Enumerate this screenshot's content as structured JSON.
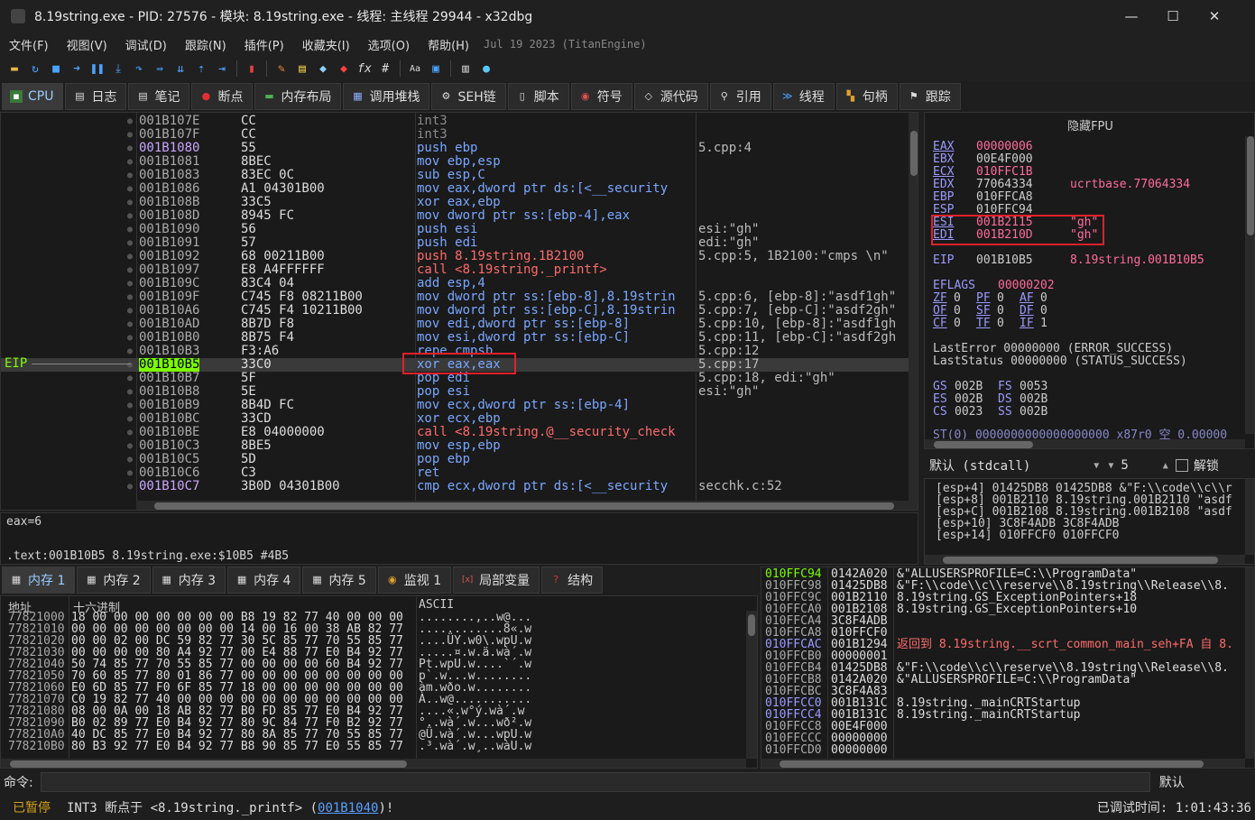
{
  "window": {
    "title": "8.19string.exe - PID: 27576 - 模块: 8.19string.exe - 线程: 主线程 29944 - x32dbg",
    "minimize": "—",
    "maximize": "☐",
    "close": "✕"
  },
  "menu": {
    "items": [
      "文件(F)",
      "视图(V)",
      "调试(D)",
      "跟踪(N)",
      "插件(P)",
      "收藏夹(I)",
      "选项(O)",
      "帮助(H)"
    ],
    "date": "Jul 19 2023 (TitanEngine)"
  },
  "tabs": [
    "CPU",
    "日志",
    "笔记",
    "断点",
    "内存布局",
    "调用堆栈",
    "SEH链",
    "脚本",
    "符号",
    "源代码",
    "引用",
    "线程",
    "句柄",
    "跟踪"
  ],
  "disasm": {
    "eip_label": "EIP",
    "rows": [
      {
        "addr": "001B107E",
        "bytes": "CC",
        "instr": "int3",
        "cmt": ""
      },
      {
        "addr": "001B107F",
        "bytes": "CC",
        "instr": "int3",
        "cmt": ""
      },
      {
        "addr": "001B1080",
        "bytes": "55",
        "instr": "push ebp",
        "cmt": "5.cpp:4"
      },
      {
        "addr": "001B1081",
        "bytes": "8BEC",
        "instr": "mov ebp,esp",
        "cmt": ""
      },
      {
        "addr": "001B1083",
        "bytes": "83EC 0C",
        "instr": "sub esp,C",
        "cmt": ""
      },
      {
        "addr": "001B1086",
        "bytes": "A1 04301B00",
        "instr": "mov eax,dword ptr ds:[<__security",
        "cmt": ""
      },
      {
        "addr": "001B108B",
        "bytes": "33C5",
        "instr": "xor eax,ebp",
        "cmt": ""
      },
      {
        "addr": "001B108D",
        "bytes": "8945 FC",
        "instr": "mov dword ptr ss:[ebp-4],eax",
        "cmt": ""
      },
      {
        "addr": "001B1090",
        "bytes": "56",
        "instr": "push esi",
        "cmt": "esi:\"gh\""
      },
      {
        "addr": "001B1091",
        "bytes": "57",
        "instr": "push edi",
        "cmt": "edi:\"gh\""
      },
      {
        "addr": "001B1092",
        "bytes": "68 00211B00",
        "instr": "push 8.19string.1B2100",
        "cmt": "5.cpp:5, 1B2100:\"cmps \\n\""
      },
      {
        "addr": "001B1097",
        "bytes": "E8 A4FFFFFF",
        "instr": "call <8.19string._printf>",
        "cmt": ""
      },
      {
        "addr": "001B109C",
        "bytes": "83C4 04",
        "instr": "add esp,4",
        "cmt": ""
      },
      {
        "addr": "001B109F",
        "bytes": "C745 F8 08211B00",
        "instr": "mov dword ptr ss:[ebp-8],8.19strin",
        "cmt": "5.cpp:6, [ebp-8]:\"asdf1gh\""
      },
      {
        "addr": "001B10A6",
        "bytes": "C745 F4 10211B00",
        "instr": "mov dword ptr ss:[ebp-C],8.19strin",
        "cmt": "5.cpp:7, [ebp-C]:\"asdf2gh\""
      },
      {
        "addr": "001B10AD",
        "bytes": "8B7D F8",
        "instr": "mov edi,dword ptr ss:[ebp-8]",
        "cmt": "5.cpp:10, [ebp-8]:\"asdf1gh"
      },
      {
        "addr": "001B10B0",
        "bytes": "8B75 F4",
        "instr": "mov esi,dword ptr ss:[ebp-C]",
        "cmt": "5.cpp:11, [ebp-C]:\"asdf2gh"
      },
      {
        "addr": "001B10B3",
        "bytes": "F3:A6",
        "instr": "repe cmpsb",
        "cmt": "5.cpp:12"
      },
      {
        "addr": "001B10B5",
        "bytes": "33C0",
        "instr": "xor eax,eax",
        "cmt": "5.cpp:17"
      },
      {
        "addr": "001B10B7",
        "bytes": "5F",
        "instr": "pop edi",
        "cmt": "5.cpp:18, edi:\"gh\""
      },
      {
        "addr": "001B10B8",
        "bytes": "5E",
        "instr": "pop esi",
        "cmt": "esi:\"gh\""
      },
      {
        "addr": "001B10B9",
        "bytes": "8B4D FC",
        "instr": "mov ecx,dword ptr ss:[ebp-4]",
        "cmt": ""
      },
      {
        "addr": "001B10BC",
        "bytes": "33CD",
        "instr": "xor ecx,ebp",
        "cmt": ""
      },
      {
        "addr": "001B10BE",
        "bytes": "E8 04000000",
        "instr": "call <8.19string.@__security_check",
        "cmt": ""
      },
      {
        "addr": "001B10C3",
        "bytes": "8BE5",
        "instr": "mov esp,ebp",
        "cmt": ""
      },
      {
        "addr": "001B10C5",
        "bytes": "5D",
        "instr": "pop ebp",
        "cmt": ""
      },
      {
        "addr": "001B10C6",
        "bytes": "C3",
        "instr": "ret",
        "cmt": ""
      },
      {
        "addr": "001B10C7",
        "bytes": "3B0D 04301B00",
        "instr": "cmp ecx,dword ptr ds:[<__security",
        "cmt": "secchk.c:52"
      }
    ]
  },
  "info": {
    "line1": "eax=6",
    "line2": ".text:001B10B5 8.19string.exe:$10B5 #4B5"
  },
  "registers": {
    "header": "隐藏FPU",
    "gp": [
      {
        "name": "EAX",
        "value": "00000006",
        "extra": ""
      },
      {
        "name": "EBX",
        "value": "00E4F000",
        "extra": ""
      },
      {
        "name": "ECX",
        "value": "010FFC1B",
        "extra": ""
      },
      {
        "name": "EDX",
        "value": "77064334",
        "extra": "ucrtbase.77064334"
      },
      {
        "name": "EBP",
        "value": "010FFCA8",
        "extra": ""
      },
      {
        "name": "ESP",
        "value": "010FFC94",
        "extra": ""
      },
      {
        "name": "ESI",
        "value": "001B2115",
        "extra": "\"gh\""
      },
      {
        "name": "EDI",
        "value": "001B210D",
        "extra": "\"gh\""
      }
    ],
    "eip": {
      "name": "EIP",
      "value": "001B10B5",
      "extra": "8.19string.001B10B5"
    },
    "eflags": {
      "name": "EFLAGS",
      "value": "00000202"
    },
    "flags": [
      [
        "ZF",
        "0",
        "PF",
        "0",
        "AF",
        "0"
      ],
      [
        "OF",
        "0",
        "SF",
        "0",
        "DF",
        "0"
      ],
      [
        "CF",
        "0",
        "TF",
        "0",
        "IF",
        "1"
      ]
    ],
    "lasterror": "LastError  00000000 (ERROR_SUCCESS)",
    "laststatus": "LastStatus 00000000 (STATUS_SUCCESS)",
    "segs": [
      [
        "GS",
        "002B",
        "FS",
        "0053"
      ],
      [
        "ES",
        "002B",
        "DS",
        "002B"
      ],
      [
        "CS",
        "0023",
        "SS",
        "002B"
      ]
    ],
    "st0": "ST(0) 0000000000000000000 x87r0 空 0.00000"
  },
  "callconv": {
    "value": "默认 (stdcall)",
    "count": "5",
    "unlock": "解锁"
  },
  "stackargs": [
    "[esp+4] 01425DB8 01425DB8 &\"F:\\\\code\\\\c\\\\r",
    "[esp+8] 001B2110 8.19string.001B2110 \"asdf",
    "[esp+C] 001B2108 8.19string.001B2108 \"asdf",
    "[esp+10] 3C8F4ADB 3C8F4ADB",
    "[esp+14] 010FFCF0 010FFCF0"
  ],
  "bottom_tabs": [
    "内存 1",
    "内存 2",
    "内存 3",
    "内存 4",
    "内存 5",
    "监视 1",
    "局部变量",
    "结构"
  ],
  "dump": {
    "h_addr": "地址",
    "h_hex": "十六进制",
    "h_ascii": "ASCII",
    "rows": [
      {
        "a": "77821000",
        "h": "18 00 00 00 00 00 00 00 B8 19 82 77 40 00 00 00",
        "c": "........,..w@..."
      },
      {
        "a": "77821010",
        "h": "00 00 00 00 00 00 00 00 14 00 16 00 38 AB 82 77",
        "c": "............8«.w"
      },
      {
        "a": "77821020",
        "h": "00 00 02 00 DC 59 82 77 30 5C 85 77 70 55 85 77",
        "c": "....ÜY.w0\\.wpU.w"
      },
      {
        "a": "77821030",
        "h": "00 00 00 00 80 A4 92 77 00 E4 88 77 E0 B4 92 77",
        "c": ".....¤.w.ä.wà´.w"
      },
      {
        "a": "77821040",
        "h": "50 74 85 77 70 55 85 77 00 00 00 00 60 B4 92 77",
        "c": "Pt.wpU.w....`´.w"
      },
      {
        "a": "77821050",
        "h": "70 60 85 77 80 01 86 77 00 00 00 00 00 00 00 00",
        "c": "p`.w...w........"
      },
      {
        "a": "77821060",
        "h": "E0 6D 85 77 F0 6F 85 77 18 00 00 00 00 00 00 00",
        "c": "àm.wðo.w........"
      },
      {
        "a": "77821070",
        "h": "C0 19 82 77 40 00 00 00 00 00 00 00 00 00 00 00",
        "c": "À..w@..........."
      },
      {
        "a": "77821080",
        "h": "08 00 0A 00 18 AB 82 77 B0 FD 85 77 E0 B4 92 77",
        "c": "....«.w°ý.wà´.w"
      },
      {
        "a": "77821090",
        "h": "B0 02 89 77 E0 B4 92 77 80 9C 84 77 F0 B2 92 77",
        "c": "°..wà´.w...wð².w"
      },
      {
        "a": "778210A0",
        "h": "40 DC 85 77 E0 B4 92 77 80 8A 85 77 70 55 85 77",
        "c": "@Ü.wà´.w...wpU.w"
      },
      {
        "a": "778210B0",
        "h": "80 B3 92 77 E0 B4 92 77 B8 90 85 77 E0 55 85 77",
        "c": ".³.wà´.w¸..wàU.w"
      }
    ]
  },
  "stack": {
    "rows": [
      {
        "a": "010FFC94",
        "v": "0142A020",
        "c": "&\"ALLUSERSPROFILE=C:\\\\ProgramData\""
      },
      {
        "a": "010FFC98",
        "v": "01425DB8",
        "c": "&\"F:\\\\code\\\\c\\\\reserve\\\\8.19string\\\\Release\\\\8."
      },
      {
        "a": "010FFC9C",
        "v": "001B2110",
        "c": "8.19string.GS_ExceptionPointers+18"
      },
      {
        "a": "010FFCA0",
        "v": "001B2108",
        "c": "8.19string.GS_ExceptionPointers+10"
      },
      {
        "a": "010FFCA4",
        "v": "3C8F4ADB",
        "c": ""
      },
      {
        "a": "010FFCA8",
        "v": "010FFCF0",
        "c": ""
      },
      {
        "a": "010FFCAC",
        "v": "001B1294",
        "c": "返回到 8.19string.__scrt_common_main_seh+FA 自 8."
      },
      {
        "a": "010FFCB0",
        "v": "00000001",
        "c": ""
      },
      {
        "a": "010FFCB4",
        "v": "01425DB8",
        "c": "&\"F:\\\\code\\\\c\\\\reserve\\\\8.19string\\\\Release\\\\8."
      },
      {
        "a": "010FFCB8",
        "v": "0142A020",
        "c": "&\"ALLUSERSPROFILE=C:\\\\ProgramData\""
      },
      {
        "a": "010FFCBC",
        "v": "3C8F4A83",
        "c": ""
      },
      {
        "a": "010FFCC0",
        "v": "001B131C",
        "c": "8.19string._mainCRTStartup"
      },
      {
        "a": "010FFCC4",
        "v": "001B131C",
        "c": "8.19string._mainCRTStartup"
      },
      {
        "a": "010FFCC8",
        "v": "00E4F000",
        "c": ""
      },
      {
        "a": "010FFCCC",
        "v": "00000000",
        "c": ""
      },
      {
        "a": "010FFCD0",
        "v": "00000000",
        "c": ""
      }
    ]
  },
  "command": {
    "label": "命令:",
    "default": "默认"
  },
  "status": {
    "paused": "已暂停",
    "msg_prefix": "INT3  断点于 <8.19string._printf> (",
    "msg_link": "001B1040",
    "msg_suffix": ")!",
    "time": "已调试时间: 1:01:43:36"
  }
}
